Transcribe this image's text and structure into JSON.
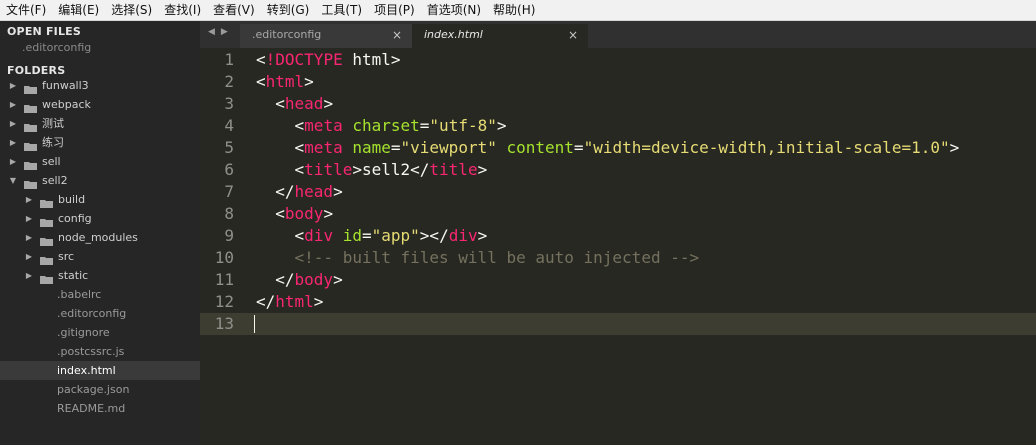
{
  "menubar": {
    "items": [
      "文件(F)",
      "编辑(E)",
      "选择(S)",
      "查找(I)",
      "查看(V)",
      "转到(G)",
      "工具(T)",
      "项目(P)",
      "首选项(N)",
      "帮助(H)"
    ]
  },
  "sidebar": {
    "open_files_title": "OPEN FILES",
    "open_files": [
      ".editorconfig"
    ],
    "folders_title": "FOLDERS",
    "tree": [
      {
        "label": "funwall3",
        "type": "folder",
        "expanded": false,
        "depth": 0
      },
      {
        "label": "webpack",
        "type": "folder",
        "expanded": false,
        "depth": 0
      },
      {
        "label": "测试",
        "type": "folder",
        "expanded": false,
        "depth": 0
      },
      {
        "label": "练习",
        "type": "folder",
        "expanded": false,
        "depth": 0
      },
      {
        "label": "sell",
        "type": "folder",
        "expanded": false,
        "depth": 0
      },
      {
        "label": "sell2",
        "type": "folder",
        "expanded": true,
        "depth": 0
      },
      {
        "label": "build",
        "type": "folder",
        "expanded": false,
        "depth": 1
      },
      {
        "label": "config",
        "type": "folder",
        "expanded": false,
        "depth": 1
      },
      {
        "label": "node_modules",
        "type": "folder",
        "expanded": false,
        "depth": 1
      },
      {
        "label": "src",
        "type": "folder",
        "expanded": false,
        "depth": 1
      },
      {
        "label": "static",
        "type": "folder",
        "expanded": false,
        "depth": 1
      },
      {
        "label": ".babelrc",
        "type": "file",
        "depth": 1
      },
      {
        "label": ".editorconfig",
        "type": "file",
        "depth": 1
      },
      {
        "label": ".gitignore",
        "type": "file",
        "depth": 1
      },
      {
        "label": ".postcssrc.js",
        "type": "file",
        "depth": 1
      },
      {
        "label": "index.html",
        "type": "file",
        "depth": 1,
        "selected": true
      },
      {
        "label": "package.json",
        "type": "file",
        "depth": 1
      },
      {
        "label": "README.md",
        "type": "file",
        "depth": 1
      }
    ]
  },
  "tabs": {
    "nav_icons": [
      "left-arrow-icon",
      "right-arrow-icon"
    ],
    "items": [
      {
        "label": ".editorconfig",
        "active": false,
        "close": "×"
      },
      {
        "label": "index.html",
        "active": true,
        "close": "×"
      }
    ]
  },
  "editor": {
    "current_line": 13,
    "lines": [
      {
        "n": "1",
        "tokens": [
          [
            "t-text",
            "<"
          ],
          [
            "t-doctype",
            "!DOCTYPE"
          ],
          [
            "t-text",
            " html>"
          ]
        ]
      },
      {
        "n": "2",
        "tokens": [
          [
            "t-text",
            "<"
          ],
          [
            "t-tag",
            "html"
          ],
          [
            "t-text",
            ">"
          ]
        ]
      },
      {
        "n": "3",
        "tokens": [
          [
            "t-text",
            "  <"
          ],
          [
            "t-tag",
            "head"
          ],
          [
            "t-text",
            ">"
          ]
        ]
      },
      {
        "n": "4",
        "tokens": [
          [
            "t-text",
            "    <"
          ],
          [
            "t-tag",
            "meta"
          ],
          [
            "t-text",
            " "
          ],
          [
            "t-attr",
            "charset"
          ],
          [
            "t-text",
            "="
          ],
          [
            "t-str",
            "\"utf-8\""
          ],
          [
            "t-text",
            ">"
          ]
        ]
      },
      {
        "n": "5",
        "tokens": [
          [
            "t-text",
            "    <"
          ],
          [
            "t-tag",
            "meta"
          ],
          [
            "t-text",
            " "
          ],
          [
            "t-attr",
            "name"
          ],
          [
            "t-text",
            "="
          ],
          [
            "t-str",
            "\"viewport\""
          ],
          [
            "t-text",
            " "
          ],
          [
            "t-attr",
            "content"
          ],
          [
            "t-text",
            "="
          ],
          [
            "t-str",
            "\"width=device-width,initial-scale=1.0\""
          ],
          [
            "t-text",
            ">"
          ]
        ]
      },
      {
        "n": "6",
        "tokens": [
          [
            "t-text",
            "    <"
          ],
          [
            "t-tag",
            "title"
          ],
          [
            "t-text",
            ">sell2</"
          ],
          [
            "t-tag",
            "title"
          ],
          [
            "t-text",
            ">"
          ]
        ]
      },
      {
        "n": "7",
        "tokens": [
          [
            "t-text",
            "  </"
          ],
          [
            "t-tag",
            "head"
          ],
          [
            "t-text",
            ">"
          ]
        ]
      },
      {
        "n": "8",
        "tokens": [
          [
            "t-text",
            "  <"
          ],
          [
            "t-tag",
            "body"
          ],
          [
            "t-text",
            ">"
          ]
        ]
      },
      {
        "n": "9",
        "tokens": [
          [
            "t-text",
            "    <"
          ],
          [
            "t-tag",
            "div"
          ],
          [
            "t-text",
            " "
          ],
          [
            "t-attr",
            "id"
          ],
          [
            "t-text",
            "="
          ],
          [
            "t-str",
            "\"app\""
          ],
          [
            "t-text",
            "></"
          ],
          [
            "t-tag",
            "div"
          ],
          [
            "t-text",
            ">"
          ]
        ]
      },
      {
        "n": "10",
        "tokens": [
          [
            "t-comment",
            "    <!-- built files will be auto injected -->"
          ]
        ]
      },
      {
        "n": "11",
        "tokens": [
          [
            "t-text",
            "  </"
          ],
          [
            "t-tag",
            "body"
          ],
          [
            "t-text",
            ">"
          ]
        ]
      },
      {
        "n": "12",
        "tokens": [
          [
            "t-text",
            "</"
          ],
          [
            "t-tag",
            "html"
          ],
          [
            "t-text",
            ">"
          ]
        ]
      },
      {
        "n": "13",
        "tokens": []
      }
    ]
  },
  "colors": {
    "editor_bg": "#272822",
    "sidebar_bg": "#262626",
    "tag": "#f92672",
    "attr": "#a6e22e",
    "string": "#e6db74",
    "comment": "#75715e"
  }
}
